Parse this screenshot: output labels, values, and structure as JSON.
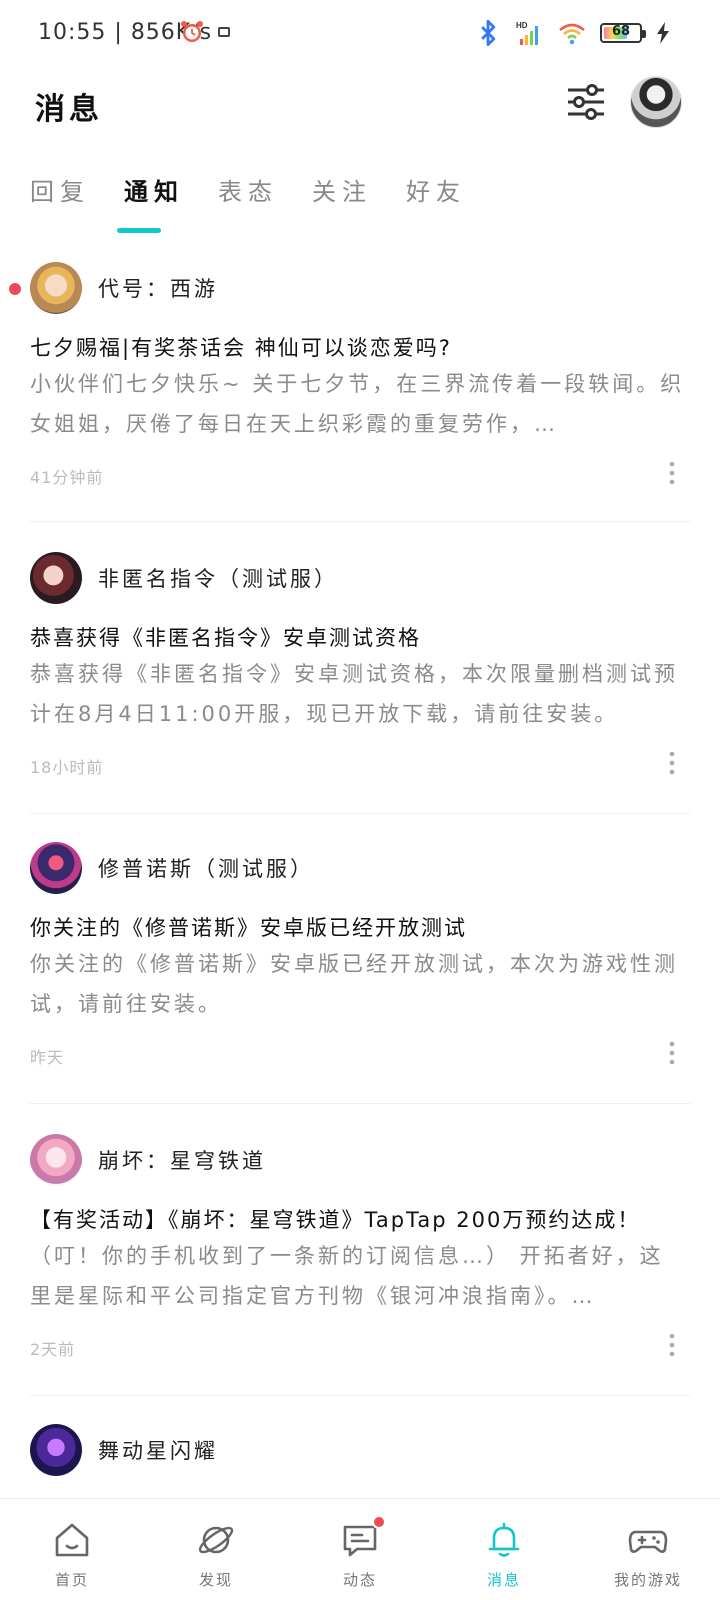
{
  "status_bar": {
    "time": "10:55",
    "speed": "856K/s",
    "battery": "68"
  },
  "header": {
    "title": "消息"
  },
  "tabs": [
    {
      "label": "回复"
    },
    {
      "label": "通知"
    },
    {
      "label": "表态"
    },
    {
      "label": "关注"
    },
    {
      "label": "好友"
    }
  ],
  "notifications": [
    {
      "source": "代号：西游",
      "title": "七夕赐福|有奖茶话会 神仙可以谈恋爱吗?",
      "body": "小伙伴们七夕快乐~ 关于七夕节，在三界流传着一段轶闻。织女姐姐，厌倦了每日在天上织彩霞的重复劳作，…",
      "time": "41分钟前",
      "unread": true
    },
    {
      "source": "非匿名指令（测试服）",
      "title": "恭喜获得《非匿名指令》安卓测试资格",
      "body": "恭喜获得《非匿名指令》安卓测试资格，本次限量删档测试预计在8月4日11:00开服，现已开放下载，请前往安装。",
      "time": "18小时前",
      "unread": false
    },
    {
      "source": "修普诺斯（测试服）",
      "title": "你关注的《修普诺斯》安卓版已经开放测试",
      "body": "你关注的《修普诺斯》安卓版已经开放测试，本次为游戏性测试，请前往安装。",
      "time": "昨天",
      "unread": false
    },
    {
      "source": "崩坏：星穹铁道",
      "title": "【有奖活动】《崩坏：星穹铁道》TapTap 200万预约达成！",
      "body": "（叮！你的手机收到了一条新的订阅信息…） 开拓者好，这里是星际和平公司指定官方刊物《银河冲浪指南》。…",
      "time": "2天前",
      "unread": false
    },
    {
      "source": "舞动星闪耀"
    }
  ],
  "bottom_nav": [
    {
      "label": "首页",
      "icon": "home-icon"
    },
    {
      "label": "发现",
      "icon": "planet-icon"
    },
    {
      "label": "动态",
      "icon": "chat-icon"
    },
    {
      "label": "消息",
      "icon": "bell-icon"
    },
    {
      "label": "我的游戏",
      "icon": "gamepad-icon"
    }
  ],
  "colors": {
    "accent": "#15c5ce",
    "unread": "#f04a59"
  }
}
